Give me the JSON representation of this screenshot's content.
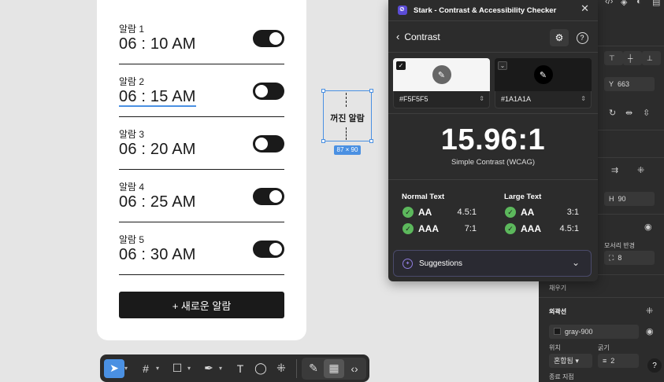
{
  "alarms": [
    {
      "label": "알람 1",
      "time": "06 : 10 AM",
      "on": true
    },
    {
      "label": "알람 2",
      "time": "06 : 15 AM",
      "on": false
    },
    {
      "label": "알람 3",
      "time": "06 : 20 AM",
      "on": false
    },
    {
      "label": "알람 4",
      "time": "06 : 25 AM",
      "on": true
    },
    {
      "label": "알람 5",
      "time": "06 : 30 AM",
      "on": true
    }
  ],
  "new_alarm_button": "+ 새로운 알람",
  "off_component": {
    "label": "꺼진 알람",
    "size": "87 × 90"
  },
  "toolbar": {
    "tools": [
      "move-tool",
      "frame-tool",
      "shape-tool",
      "pen-tool",
      "text-tool",
      "comment-tool",
      "actions-tool"
    ],
    "modes": [
      "draw-mode",
      "design-mode",
      "dev-mode"
    ]
  },
  "stark": {
    "title": "Stark - Contrast & Accessibility Checker",
    "section": "Contrast",
    "foreground_hex": "#F5F5F5",
    "background_hex": "#1A1A1A",
    "ratio": "15.96:1",
    "ratio_label": "Simple Contrast (WCAG)",
    "normal_text": {
      "title": "Normal Text",
      "aa": "AA",
      "aa_ratio": "4.5:1",
      "aaa": "AAA",
      "aaa_ratio": "7:1"
    },
    "large_text": {
      "title": "Large Text",
      "aa": "AA",
      "aa_ratio": "3:1",
      "aaa": "AAA",
      "aaa_ratio": "4.5:1"
    },
    "suggestions": "Suggestions"
  },
  "right_panel": {
    "y_label": "Y",
    "y_value": "663",
    "h_label": "H",
    "h_value": "90",
    "radius_label": "모서리 반경",
    "radius_value": "8",
    "fill_label": "채우기",
    "stroke_label": "외곽선",
    "stroke_color": "gray-900",
    "position_label": "위치",
    "position_value": "혼합됨",
    "weight_label": "굵기",
    "weight_value": "2",
    "end_label": "종료 지점",
    "help": "?"
  },
  "colors": {
    "foreground": "#F5F5F5",
    "background": "#1A1A1A",
    "pass": "#5cb85c",
    "selection": "#4a90e2"
  }
}
